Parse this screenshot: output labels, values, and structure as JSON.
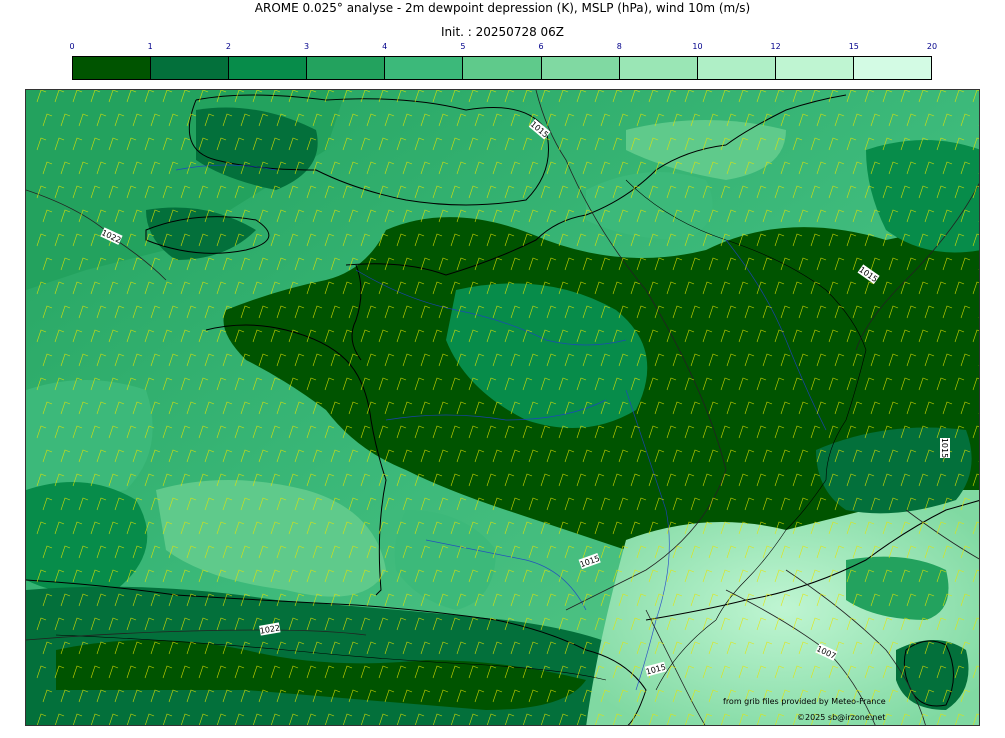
{
  "header": {
    "title": "AROME 0.025° analyse - 2m dewpoint depression (K), MSLP (hPa), wind 10m (m/s)",
    "init": "Init. : 20250728 06Z"
  },
  "colorbar": {
    "ticks": [
      "0",
      "1",
      "2",
      "3",
      "4",
      "5",
      "6",
      "8",
      "10",
      "12",
      "15",
      "20"
    ],
    "colors": [
      "#005400",
      "#03703b",
      "#078c4a",
      "#23a25e",
      "#3cb97a",
      "#5fca8b",
      "#80d9a2",
      "#9ae6b5",
      "#afefc6",
      "#bff5d2",
      "#d3fbe4"
    ]
  },
  "map": {
    "isobar_labels": [
      "1015",
      "1022",
      "1015",
      "1015",
      "1015",
      "1022",
      "1015",
      "1007",
      "1015"
    ],
    "wind_color": "#e6e600",
    "land_outline_color": "#000000",
    "river_color": "#1e40c8"
  },
  "credits": {
    "line1": "from grib files provided by Meteo-France",
    "line2": "©2025 sb@irzone.net"
  }
}
